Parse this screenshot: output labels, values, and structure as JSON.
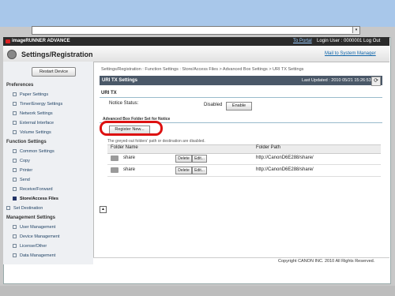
{
  "browser": {
    "address": "",
    "dropdown_icon": "▾"
  },
  "topbar": {
    "product": "imageRUNNER ADVANCE",
    "portal_link": "To Portal",
    "user_info": "Login User : 0000001 Log Out"
  },
  "header": {
    "title": "Settings/Registration",
    "mail_link": "Mail to System Manager"
  },
  "sidebar": {
    "restart_label": "Restart Device",
    "preferences_heading": "Preferences",
    "preferences": [
      "Paper Settings",
      "Timer/Energy Settings",
      "Network Settings",
      "External Interface",
      "Volume Settings"
    ],
    "function_heading": "Function Settings",
    "functions": [
      "Common Settings",
      "Copy",
      "Printer",
      "Send",
      "Receive/Forward",
      "Store/Access Files"
    ],
    "set_destination": "Set Destination",
    "management_heading": "Management Settings",
    "management": [
      "User Management",
      "Device Management",
      "License/Other",
      "Data Management"
    ]
  },
  "main": {
    "breadcrumb": "Settings/Registration : Function Settings : Store/Access Files > Advanced Box Settings > URI TX Settings",
    "title": "URI TX Settings",
    "last_updated": "Last Updated : 2010 05/21 15:26:53",
    "refresh_icon": "⟳",
    "section1": "URI TX",
    "notice_label": "Notice Status:",
    "notice_value": "Disabled",
    "enable_label": "Enable",
    "section2": "Advanced Box Folder Set for Notice",
    "register_label": "Register New...",
    "greyed_note": "The greyed-out folders' path or destination are disabled.",
    "col_folder": "Folder Name",
    "col_path": "Folder Path",
    "rows": [
      {
        "name": "share",
        "delete": "Delete",
        "edit": "Edit...",
        "path": "http://CanonD6E288/share/"
      },
      {
        "name": "share",
        "delete": "Delete",
        "edit": "Edit...",
        "path": "http://CanonD6E288/share/"
      }
    ],
    "collapse_icon": "▲"
  },
  "footer": {
    "copyright": "Copyright CANON INC. 2010 All Rights Reserved."
  },
  "colors": {
    "highlight": "#dd1111",
    "title_bar": "#4a5868",
    "chrome": "#a8c7ea"
  }
}
